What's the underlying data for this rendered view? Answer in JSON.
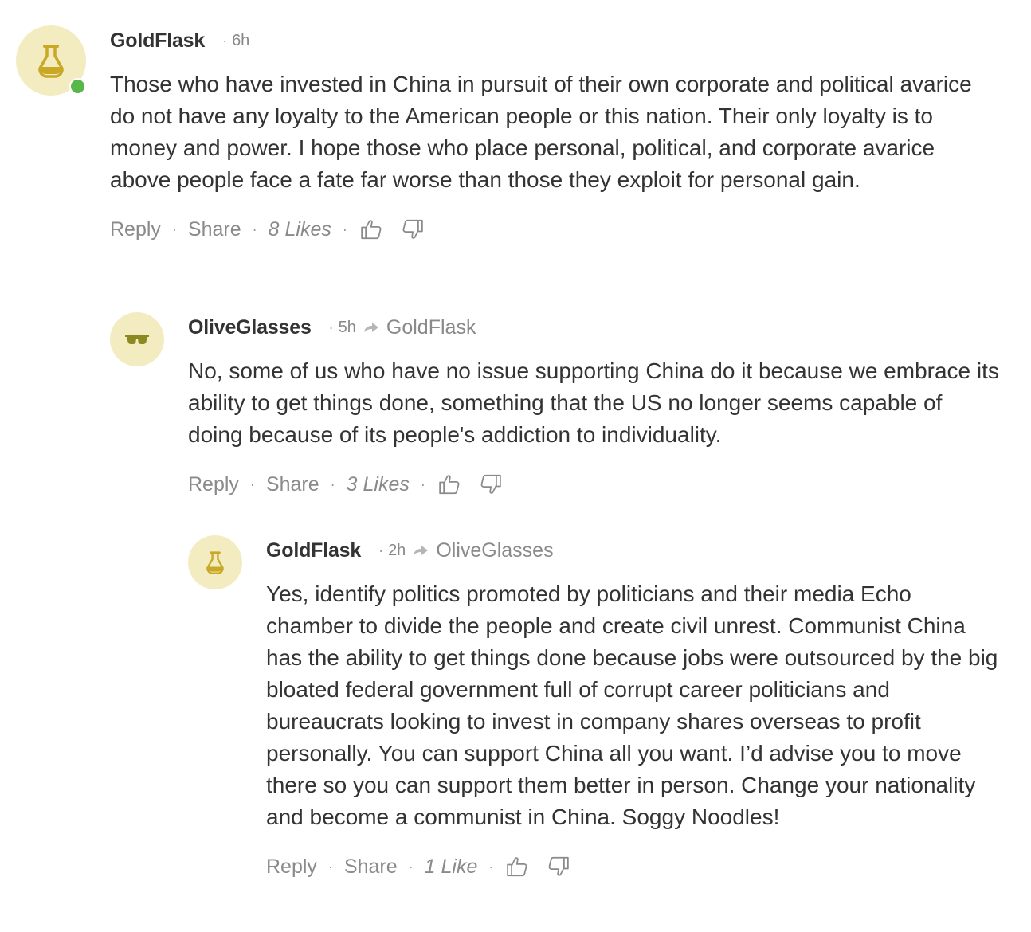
{
  "colors": {
    "avatar_bg": "#f3ecc1",
    "avatar_icon": "#c9a826",
    "online": "#56b849",
    "text": "#333333",
    "muted": "#888888"
  },
  "actions": {
    "reply_label": "Reply",
    "share_label": "Share",
    "separator": "·",
    "like_icon": "thumbs-up-icon",
    "dislike_icon": "thumbs-down-icon"
  },
  "comments": [
    {
      "author": "GoldFlask",
      "avatar_icon": "flask-icon",
      "online": true,
      "time": "6h",
      "reply_to": "",
      "body": "Those who have invested in China in pursuit of their own corporate and political avarice do not have any loyalty to the American people or this nation.  Their only loyalty is to money and power.  I hope those who place personal, political, and corporate avarice above people face a fate far worse than those they exploit for personal gain.",
      "likes": "8 Likes"
    },
    {
      "author": "OliveGlasses",
      "avatar_icon": "sunglasses-icon",
      "online": false,
      "time": "5h",
      "reply_to": "GoldFlask",
      "body": "No, some of us who have no issue supporting China do it because we embrace its ability to get things done, something that the US no longer seems capable of doing because of its people's addiction to individuality.",
      "likes": "3 Likes"
    },
    {
      "author": "GoldFlask",
      "avatar_icon": "flask-icon",
      "online": false,
      "time": "2h",
      "reply_to": "OliveGlasses",
      "body": "Yes, identify politics promoted by politicians and their media Echo chamber to divide the people and create civil unrest.  Communist China has the ability to get things done because jobs were outsourced by the big bloated federal government full of corrupt career politicians and bureaucrats looking to invest in company shares overseas to profit personally.  You can support China all you want.  I’d advise you to move there so you can support them better in person.  Change your nationality and become a communist in China.  Soggy Noodles!",
      "likes": "1 Like"
    }
  ]
}
